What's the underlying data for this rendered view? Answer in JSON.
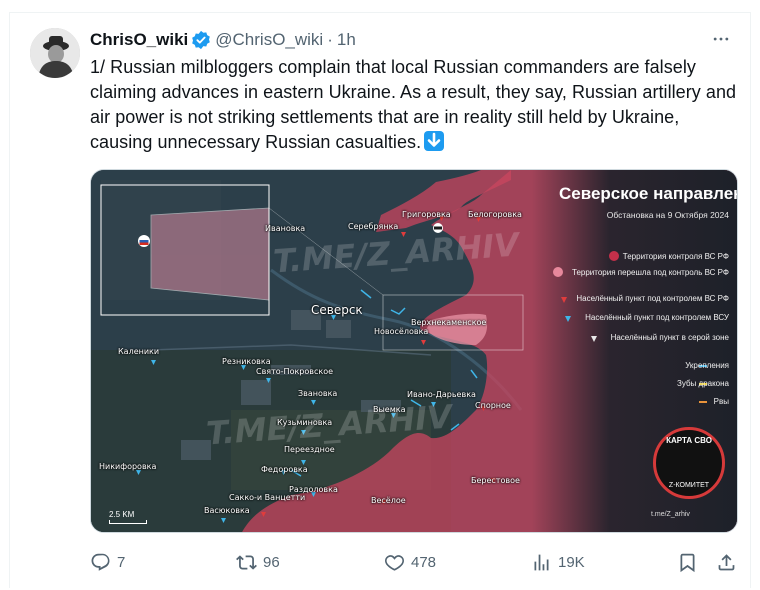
{
  "tweet": {
    "display_name": "ChrisO_wiki",
    "handle": "@ChrisO_wiki",
    "separator": "·",
    "time": "1h",
    "text": "1/ Russian milbloggers complain that local Russian commanders are falsely claiming advances in eastern Ukraine. As a result, they say, Russian artillery and air power is not striking settlements that are in reality still held by Ukraine, causing unnecessary Russian casualties.",
    "emoji": "down-arrow-emoji"
  },
  "map": {
    "title": "Северское направление",
    "subtitle": "Обстановка на 9 Октября 2024",
    "legend": [
      {
        "label": "Территория контроля ВС РФ",
        "color": "#c4304a",
        "shape": "circle"
      },
      {
        "label": "Территория перешла под контроль ВС РФ",
        "color": "#e7889c",
        "shape": "circle"
      },
      {
        "label": "Населённый пункт под контролем ВС РФ",
        "color": "#e03c3c",
        "shape": "triangle"
      },
      {
        "label": "Населённый пункт под контролем ВСУ",
        "color": "#3fb5e8",
        "shape": "triangle"
      },
      {
        "label": "Населённый пункт в серой зоне",
        "color": "#e8e8e8",
        "shape": "triangle"
      },
      {
        "label": "Укрепления",
        "color": "#3fb5e8",
        "shape": "line"
      },
      {
        "label": "Зубы дракона",
        "color": "#f2d22e",
        "shape": "line"
      },
      {
        "label": "Рвы",
        "color": "#e8933b",
        "shape": "line"
      }
    ],
    "places": {
      "seversk": "Северск",
      "grigorovka": "Григоровка",
      "belogorovka": "Белогоровка",
      "serebryanka": "Серебрянка",
      "ivanovka": "Ивановка",
      "verkhnekamenskoe": "Верхнекаменское",
      "novoselovka": "Новосёловка",
      "kalenyky": "Каленики",
      "reznikovka": "Резниковка",
      "svyato_pokrovskoe": "Свято-Покровское",
      "zvanovka": "Звановка",
      "ivano_daryevka": "Ивано-Дарьевка",
      "spornoe": "Спорное",
      "vyemka": "Выемка",
      "kuzminovka": "Кузьминовка",
      "pereezdnoe": "Переездное",
      "nikiforovka": "Никифоровка",
      "fedorovka": "Федоровка",
      "razdolovka": "Раздоловка",
      "sakko_i_vantsetti": "Сакко-и Ванцетти",
      "vasyukovka": "Васюковка",
      "veseloe": "Весёлое",
      "berestovoe": "Берестовое"
    },
    "watermark": "T.ME/Z_ARHIV",
    "scale": "2.5 KM",
    "badge_top": "КАРТА СВО",
    "badge_bottom": "Z-КОМИТЕТ",
    "channel": "t.me/Z_arhiv",
    "colors": {
      "russian_zone": "#c9455f",
      "ukraine_terrain": "#2c3f4a",
      "legend_bg": "#1d2129"
    }
  },
  "actions": {
    "replies": "7",
    "reposts": "96",
    "likes": "478",
    "views": "19K"
  }
}
